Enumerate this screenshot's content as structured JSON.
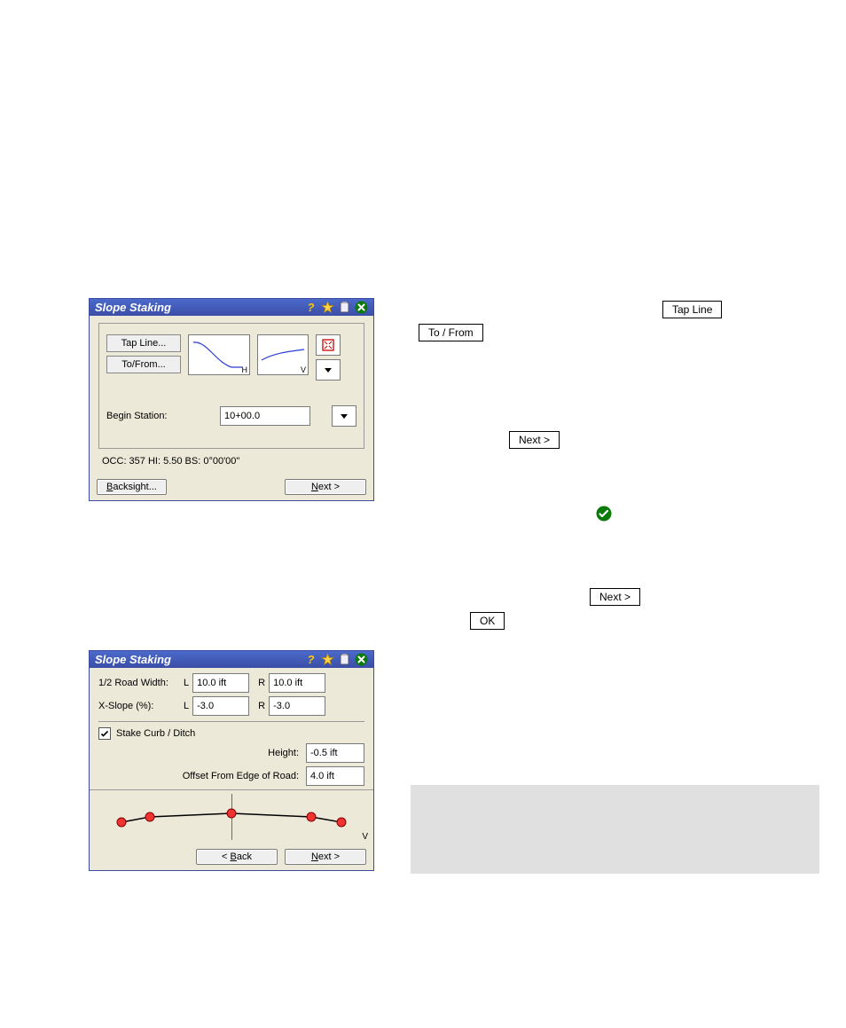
{
  "calls": {
    "c1": "Tap Line",
    "c2": "To / From",
    "c3": "Next >",
    "c4": "Next >",
    "c5": "OK"
  },
  "win1": {
    "title": "Slope Staking",
    "tapLine": "Tap Line...",
    "toFrom": "To/From...",
    "beginStationLabel": "Begin Station:",
    "beginStationValue": "10+00.0",
    "status": "OCC: 357  HI: 5.50  BS: 0°00'00\"",
    "backsight": "Backsight...",
    "next": "Next >"
  },
  "win2": {
    "title": "Slope Staking",
    "halfRoadLabel": "1/2 Road Width:",
    "xslopeLabel": "X-Slope (%):",
    "L": "L",
    "R": "R",
    "halfRoadL": "10.0 ift",
    "halfRoadR": "10.0 ift",
    "xslopeL": "-3.0",
    "xslopeR": "-3.0",
    "stakeCurb": "Stake Curb / Ditch",
    "heightLabel": "Height:",
    "heightVal": "-0.5 ift",
    "offsetLabel": "Offset From Edge of Road:",
    "offsetVal": "4.0 ift",
    "vLabel": "V",
    "back": "< Back",
    "next": "Next >"
  },
  "icons": {
    "help": "help-icon",
    "star": "star-icon",
    "clipboard": "clipboard-icon",
    "close": "close-icon",
    "zoomext": "zoom-extents-icon",
    "dropdown": "chevron-down-icon",
    "ok": "ok-check-icon"
  }
}
